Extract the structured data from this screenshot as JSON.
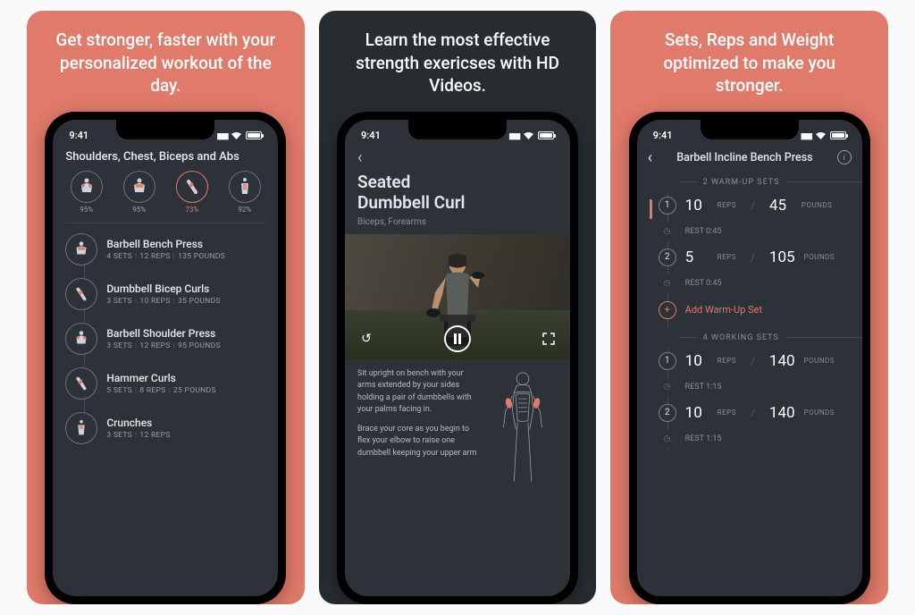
{
  "status_time": "9:41",
  "panels": [
    {
      "headline": "Get stronger, faster with your personalized workout of the day.",
      "subtitle": "Shoulders, Chest, Biceps and Abs",
      "muscles": [
        {
          "pct": "95%"
        },
        {
          "pct": "95%"
        },
        {
          "pct": "73%"
        },
        {
          "pct": "92%"
        }
      ],
      "exercises": [
        {
          "name": "Barbell Bench Press",
          "sets": "4 SETS",
          "reps": "12 REPS",
          "weight": "135 POUNDS"
        },
        {
          "name": "Dumbbell Bicep Curls",
          "sets": "3 SETS",
          "reps": "10 REPS",
          "weight": "35 POUNDS"
        },
        {
          "name": "Barbell Shoulder Press",
          "sets": "3 SETS",
          "reps": "12 REPS",
          "weight": "95 POUNDS"
        },
        {
          "name": "Hammer Curls",
          "sets": "5 SETS",
          "reps": "8 REPS",
          "weight": "25 POUNDS"
        },
        {
          "name": "Crunches",
          "sets": "3 SETS",
          "reps": "12 REPS",
          "weight": ""
        }
      ]
    },
    {
      "headline": "Learn the most effective strength exericses with HD Videos.",
      "title_line1": "Seated",
      "title_line2": "Dumbbell Curl",
      "subtitle": "Biceps, Forearms",
      "para1": "Sit upright on bench with your arms extended by your sides holding a pair of dumbbells with your palms facing in.",
      "para2": "Brace your core as you begin to flex your elbow to raise one dumbbell keeping your upper arm"
    },
    {
      "headline": "Sets, Reps and Weight optimized to make you stronger.",
      "title": "Barbell Incline Bench Press",
      "warmup_label": "2 WARM-UP SETS",
      "warmup_sets": [
        {
          "n": "1",
          "reps": "10",
          "weight": "45"
        },
        {
          "n": "2",
          "reps": "5",
          "weight": "105"
        }
      ],
      "rest_warmup": "REST 0:45",
      "add_label": "Add Warm-Up Set",
      "working_label": "4 WORKING SETS",
      "working_sets": [
        {
          "n": "1",
          "reps": "10",
          "weight": "140"
        },
        {
          "n": "2",
          "reps": "10",
          "weight": "140"
        }
      ],
      "rest_working": "REST 1:15",
      "reps_unit": "REPS",
      "weight_unit": "POUNDS"
    }
  ]
}
